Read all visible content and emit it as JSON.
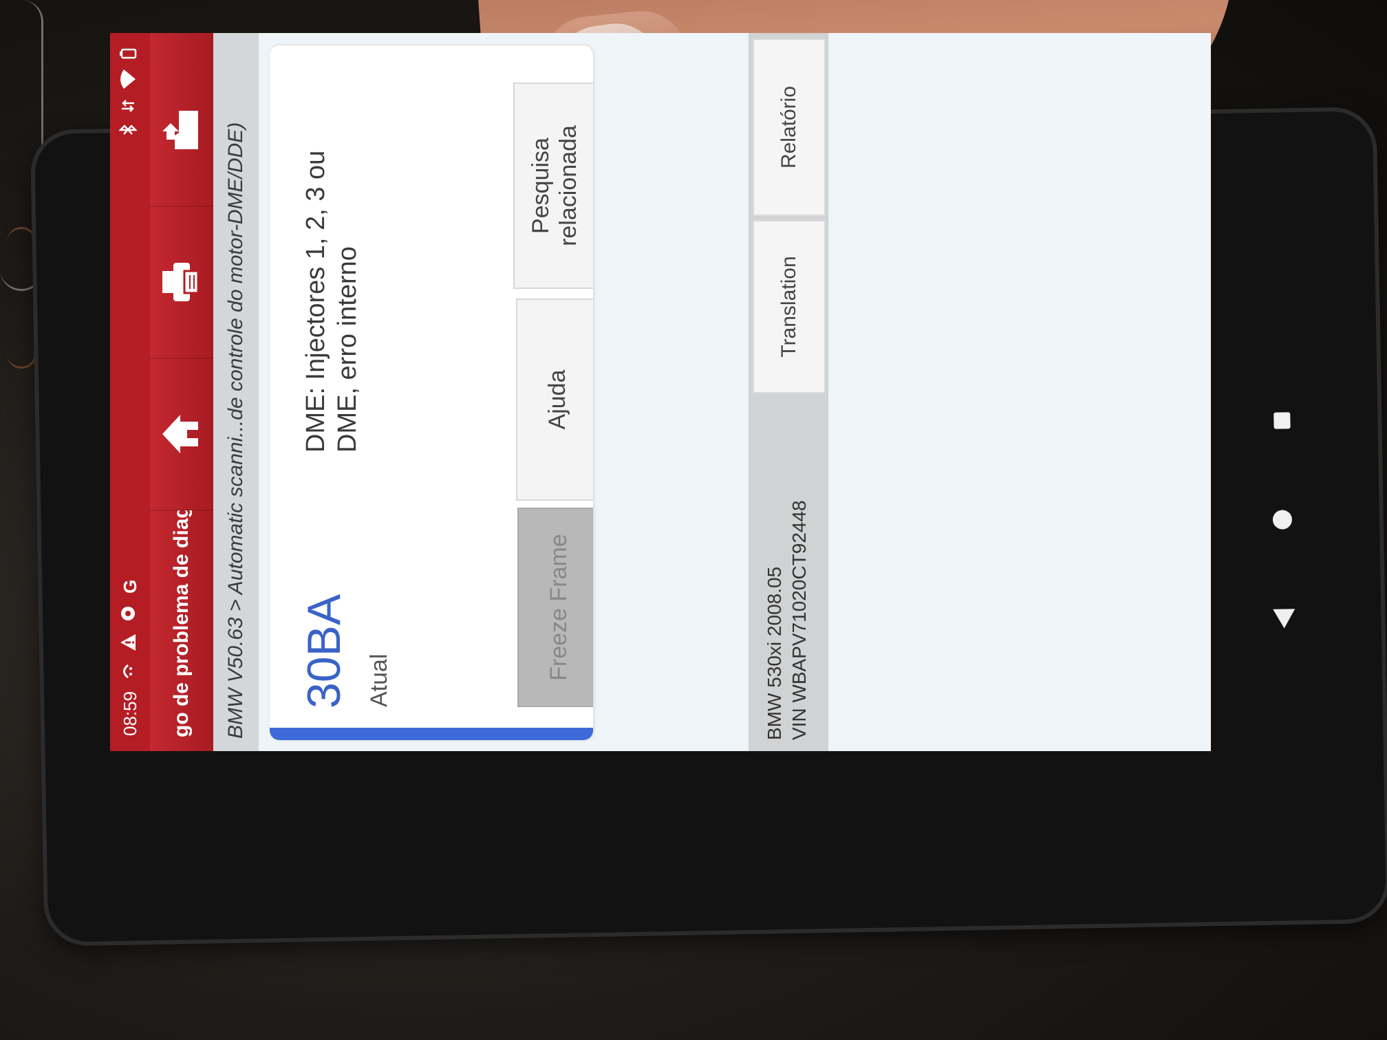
{
  "statusbar": {
    "time": "08:59",
    "icons": [
      "usb-debug-icon",
      "warning-icon",
      "sync-icon",
      "google-icon"
    ],
    "right_icons": [
      "bluetooth-icon",
      "data-icon",
      "wifi-icon",
      "battery-icon"
    ],
    "google_glyph": "G"
  },
  "appbar": {
    "title": "go de problema de diagnóstic",
    "buttons": [
      "home-icon",
      "print-icon",
      "export-icon"
    ]
  },
  "breadcrumb": "BMW V50.63 > Automatic scanni...de controle do motor-DME/DDE)",
  "fault": {
    "code": "30BA",
    "status": "Atual",
    "description_line1": "DME: Injectores 1, 2, 3 ou",
    "description_line2": "DME, erro interno",
    "buttons": {
      "freeze_frame": "Freeze Frame",
      "help": "Ajuda",
      "related_line1": "Pesquisa",
      "related_line2": "relacionada"
    }
  },
  "footer": {
    "vehicle": "BMW 530xi 2008.05",
    "vin": "VIN WBAPV71020CT92448",
    "translation": "Translation",
    "report": "Relatório"
  },
  "colors": {
    "brand_red": "#b51d24",
    "code_blue": "#3a63c8",
    "accent_blue": "#3d6ad8"
  }
}
